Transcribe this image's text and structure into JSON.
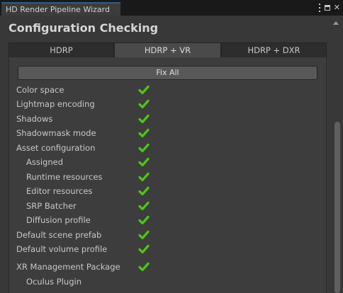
{
  "window": {
    "tab_title": "HD Render Pipeline Wizard",
    "controls": {
      "menu_icon": "kebab-menu-icon",
      "maximize_icon": "maximize-icon",
      "close_icon": "close-icon"
    }
  },
  "page": {
    "heading": "Configuration Checking"
  },
  "tabs": [
    {
      "label": "HDRP",
      "active": false
    },
    {
      "label": "HDRP + VR",
      "active": true
    },
    {
      "label": "HDRP + DXR",
      "active": false
    }
  ],
  "fix_all_label": "Fix All",
  "checks": [
    {
      "label": "Color space",
      "indent": false,
      "status": "ok"
    },
    {
      "label": "Lightmap encoding",
      "indent": false,
      "status": "ok"
    },
    {
      "label": "Shadows",
      "indent": false,
      "status": "ok"
    },
    {
      "label": "Shadowmask mode",
      "indent": false,
      "status": "ok"
    },
    {
      "label": "Asset configuration",
      "indent": false,
      "status": "ok"
    },
    {
      "label": "Assigned",
      "indent": true,
      "status": "ok"
    },
    {
      "label": "Runtime resources",
      "indent": true,
      "status": "ok"
    },
    {
      "label": "Editor resources",
      "indent": true,
      "status": "ok"
    },
    {
      "label": "SRP Batcher",
      "indent": true,
      "status": "ok"
    },
    {
      "label": "Diffusion profile",
      "indent": true,
      "status": "ok"
    },
    {
      "label": "Default scene prefab",
      "indent": false,
      "status": "ok"
    },
    {
      "label": "Default volume profile",
      "indent": false,
      "status": "ok"
    },
    {
      "label": "XR Management Package",
      "indent": false,
      "status": "ok"
    },
    {
      "label": "Oculus Plugin",
      "indent": true,
      "status": "none"
    }
  ],
  "colors": {
    "check_green": "#4fc51b",
    "accent_blue": "#2c5d87"
  }
}
